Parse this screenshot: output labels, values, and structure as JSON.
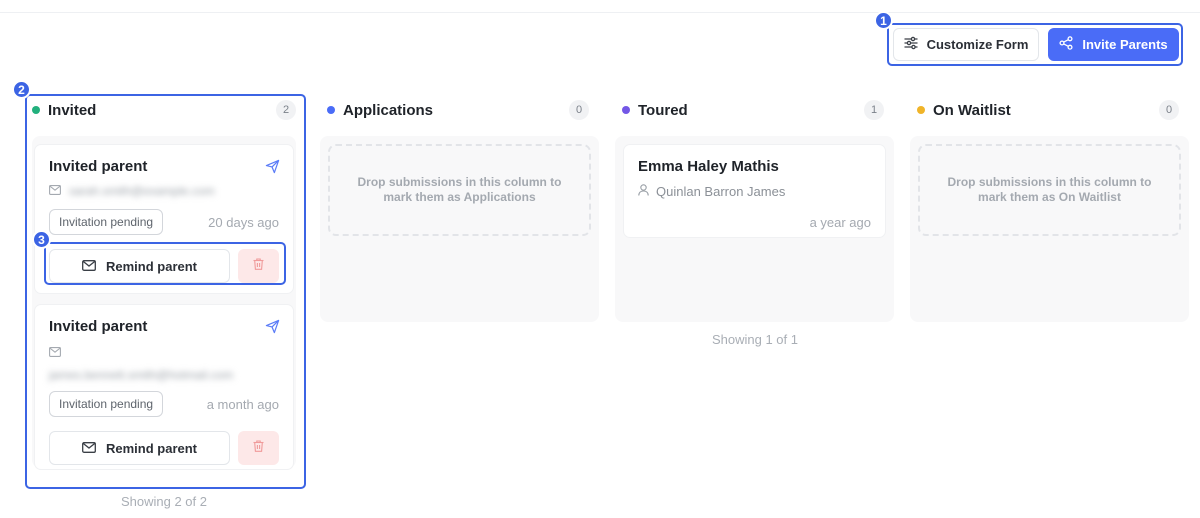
{
  "toolbar": {
    "customize_label": "Customize Form",
    "invite_label": "Invite Parents"
  },
  "annotations": [
    "1",
    "2",
    "3"
  ],
  "colors": {
    "accent": "#4a6cf7",
    "annotation": "#3c64e4",
    "invited_dot": "#22b07d",
    "applications_dot": "#4a6cf7",
    "toured_dot": "#7357e6",
    "waitlist_dot": "#f0b429"
  },
  "columns": {
    "invited": {
      "title": "Invited",
      "count": "2",
      "cards": [
        {
          "title": "Invited parent",
          "email": "sarah.smith@example.com",
          "status": "Invitation pending",
          "ago": "20 days ago",
          "remind_label": "Remind parent"
        },
        {
          "title": "Invited parent",
          "email": "james.bennett.smith@hotmail.com",
          "status": "Invitation pending",
          "ago": "a month ago",
          "remind_label": "Remind parent"
        }
      ],
      "showing": "Showing 2 of 2"
    },
    "applications": {
      "title": "Applications",
      "count": "0",
      "drop_text": "Drop submissions in this column to mark them as Applications"
    },
    "toured": {
      "title": "Toured",
      "count": "1",
      "cards": [
        {
          "title": "Emma Haley Mathis",
          "person": "Quinlan Barron James",
          "ago": "a year ago"
        }
      ],
      "showing": "Showing 1 of 1"
    },
    "waitlist": {
      "title": "On Waitlist",
      "count": "0",
      "drop_text": "Drop submissions in this column to mark them as On Waitlist"
    }
  }
}
